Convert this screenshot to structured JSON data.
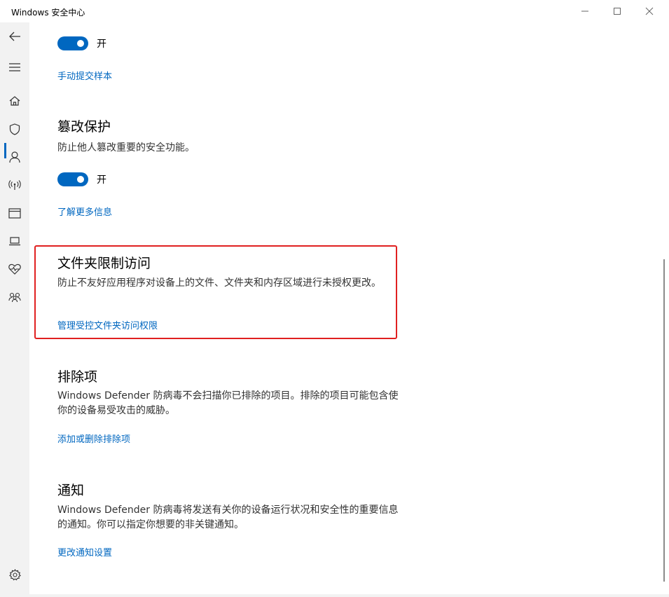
{
  "window": {
    "title": "Windows 安全中心"
  },
  "sidebar": {
    "items": [
      {
        "icon": "back-icon"
      },
      {
        "icon": "menu-icon"
      },
      {
        "icon": "home-icon"
      },
      {
        "icon": "shield-icon",
        "active": true
      },
      {
        "icon": "person-icon"
      },
      {
        "icon": "wireless-icon"
      },
      {
        "icon": "browser-icon"
      },
      {
        "icon": "laptop-icon"
      },
      {
        "icon": "heart-icon"
      },
      {
        "icon": "family-icon"
      },
      {
        "icon": "gear-icon"
      }
    ]
  },
  "main": {
    "top_toggle": {
      "state": "开",
      "on": true
    },
    "submit_sample_link": "手动提交样本",
    "tamper": {
      "title": "篡改保护",
      "description": "防止他人篡改重要的安全功能。",
      "toggle": {
        "state": "开",
        "on": true
      },
      "link": "了解更多信息"
    },
    "folder_access": {
      "title": "文件夹限制访问",
      "description": "防止不友好应用程序对设备上的文件、文件夹和内存区域进行未授权更改。",
      "link": "管理受控文件夹访问权限"
    },
    "exclusions": {
      "title": "排除项",
      "description": "Windows Defender 防病毒不会扫描你已排除的项目。排除的项目可能包含使你的设备易受攻击的威胁。",
      "link": "添加或删除排除项"
    },
    "notifications": {
      "title": "通知",
      "description": "Windows Defender 防病毒将发送有关你的设备运行状况和安全性的重要信息的通知。你可以指定你想要的非关键通知。",
      "link": "更改通知设置"
    }
  },
  "colors": {
    "accent": "#0067c0",
    "highlight_border": "#e02020",
    "sidebar_bg": "#f2f2f2"
  }
}
